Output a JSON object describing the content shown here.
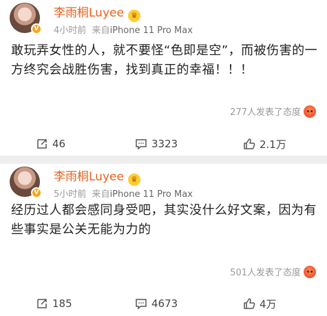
{
  "posts": [
    {
      "author": "李雨桐Luyee",
      "time": "4小时前",
      "source_prefix": "来自",
      "device": "iPhone 11 Pro Max",
      "content": "敢玩弄女性的人，就不要怪“色即是空”，而被伤害的一方终究会战胜伤害，找到真正的幸福！！！",
      "reactions": "277人发表了态度",
      "reposts": "46",
      "comments": "3323",
      "likes": "2.1万"
    },
    {
      "author": "李雨桐Luyee",
      "time": "5小时前",
      "source_prefix": "来自",
      "device": "iPhone 11 Pro Max",
      "content": "经历过人都会感同身受吧，其实没什么好文案，因为有些事实是公关无能为力的",
      "reactions": "501人发表了态度",
      "reposts": "185",
      "comments": "4673",
      "likes": "4万"
    }
  ],
  "colors": {
    "author": "#e8601d",
    "meta": "#999999",
    "separator": "#eeeeee",
    "badge": "#f8a41a"
  },
  "icons": [
    "avatar",
    "verified-badge-icon",
    "member-crown-icon",
    "angry-emoji-icon",
    "repost-icon",
    "comment-icon",
    "like-icon"
  ]
}
